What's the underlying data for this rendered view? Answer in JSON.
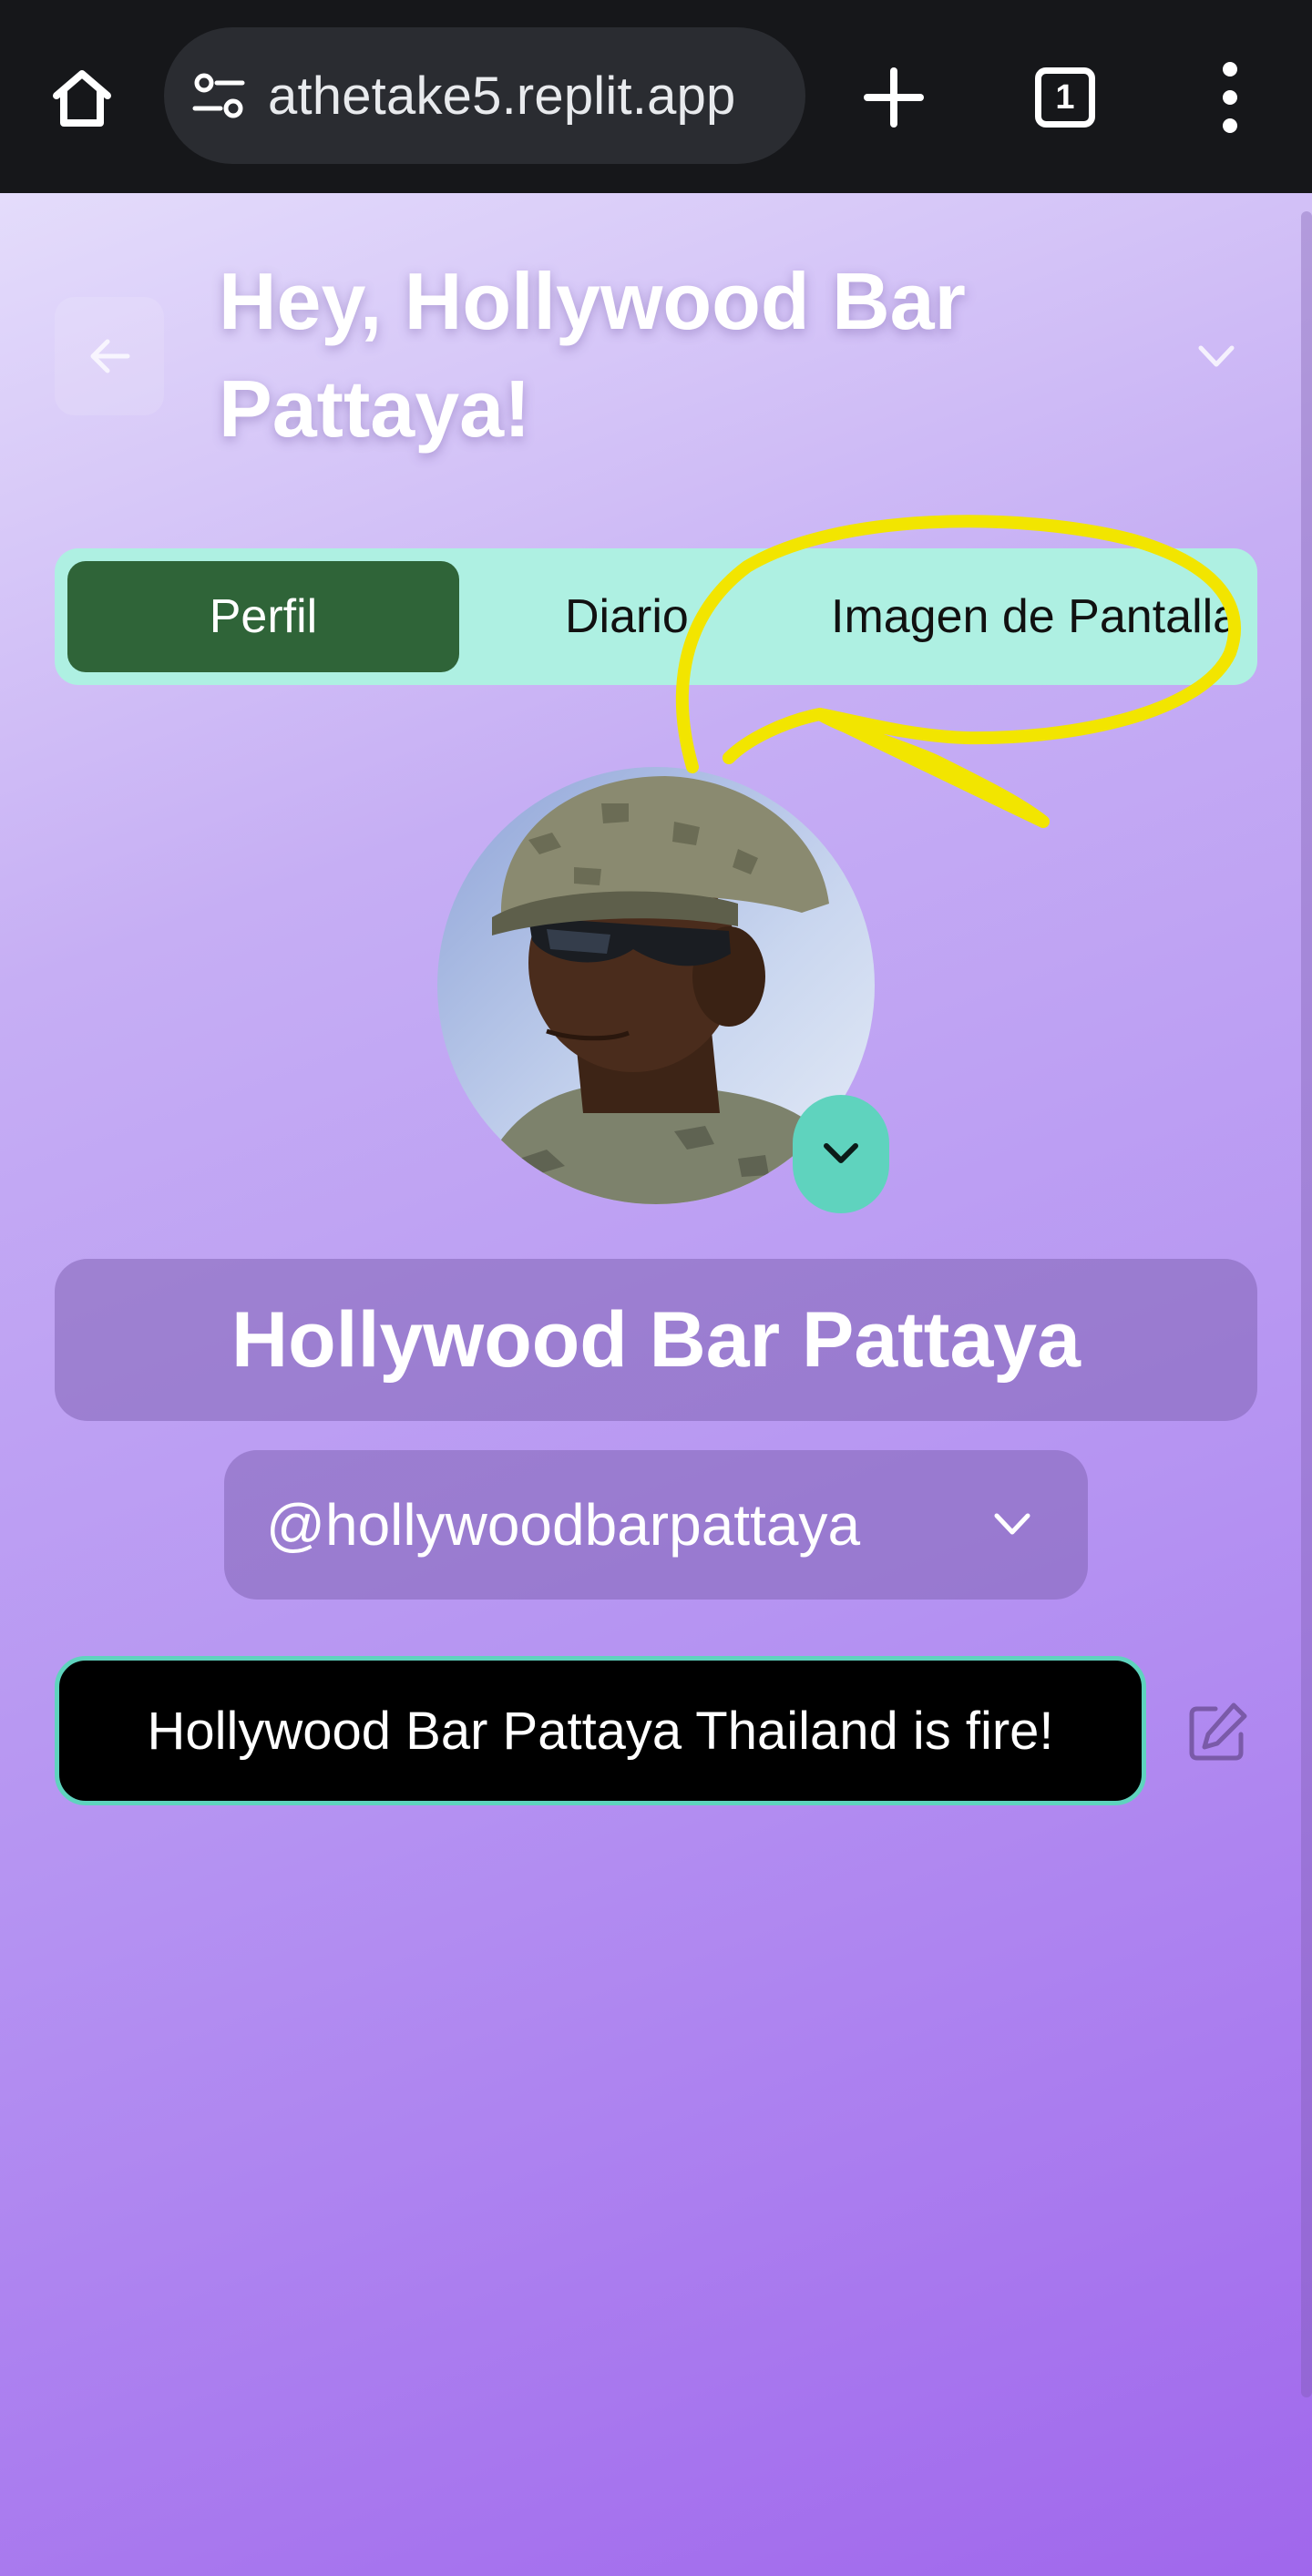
{
  "browser": {
    "url": "athetake5.replit.app",
    "tab_count": "1",
    "icons": [
      "home-icon",
      "site-settings-icon",
      "new-tab-icon",
      "tab-switcher-icon",
      "more-menu-icon"
    ]
  },
  "header": {
    "greeting": "Hey, Hollywood Bar Pattaya!",
    "back_icon": "arrow-left-icon",
    "menu_icon": "chevron-down-icon"
  },
  "tabs": [
    {
      "label": "Perfil",
      "active": true
    },
    {
      "label": "Diario",
      "active": false
    },
    {
      "label": "Imagen de Pantalla",
      "active": false
    }
  ],
  "profile": {
    "avatar_alt": "profile photo",
    "name": "Hollywood Bar Pattaya",
    "handle": "@hollywoodbarpattaya",
    "status": "Hollywood Bar Pattaya Thailand is fire!"
  },
  "colors": {
    "tab_bar": "#aef0e2",
    "active_tab": "#2f6438",
    "accent": "#5fd3be",
    "annotation": "#f2e500"
  }
}
